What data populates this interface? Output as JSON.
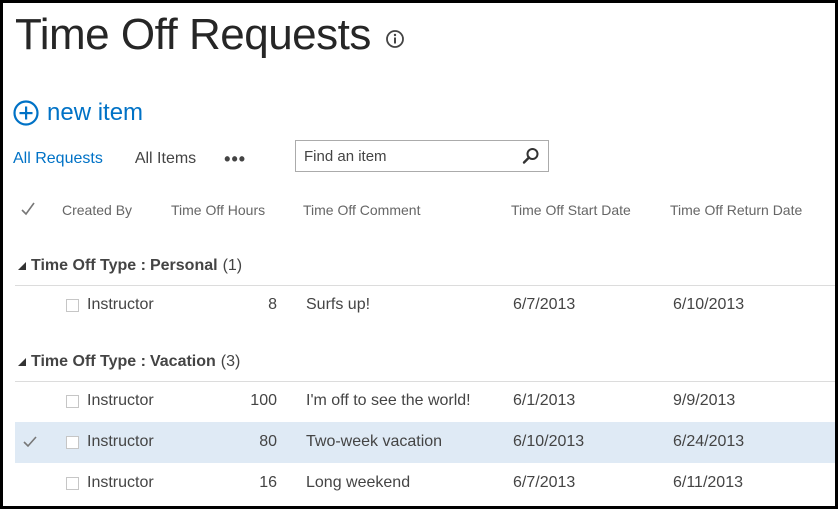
{
  "page": {
    "title": "Time Off Requests"
  },
  "toolbar": {
    "new_item_label": "new item"
  },
  "views": {
    "items": [
      "All Requests",
      "All Items"
    ],
    "more": "•••"
  },
  "search": {
    "placeholder": "Find an item"
  },
  "columns": [
    "Created By",
    "Time Off Hours",
    "Time Off Comment",
    "Time Off Start Date",
    "Time Off Return Date"
  ],
  "groups": [
    {
      "label": "Time Off Type :",
      "value": "Personal",
      "count": "(1)",
      "rows": [
        {
          "created_by": "Instructor",
          "hours": "8",
          "comment": "Surfs up!",
          "start": "6/7/2013",
          "return": "6/10/2013",
          "selected": false
        }
      ]
    },
    {
      "label": "Time Off Type :",
      "value": "Vacation",
      "count": "(3)",
      "rows": [
        {
          "created_by": "Instructor",
          "hours": "100",
          "comment": "I'm off to see the world!",
          "start": "6/1/2013",
          "return": "9/9/2013",
          "selected": false
        },
        {
          "created_by": "Instructor",
          "hours": "80",
          "comment": "Two-week vacation",
          "start": "6/10/2013",
          "return": "6/24/2013",
          "selected": true
        },
        {
          "created_by": "Instructor",
          "hours": "16",
          "comment": "Long weekend",
          "start": "6/7/2013",
          "return": "6/11/2013",
          "selected": false
        }
      ]
    }
  ],
  "colors": {
    "accent": "#0072c6",
    "selected_row": "#dfeaf5",
    "title": "#262626",
    "text": "#444444"
  },
  "icons": {
    "info": "info-icon",
    "new_item": "plus-circle-icon",
    "search": "magnifier-icon",
    "select_all": "checkmark-icon",
    "group_toggle": "triangle-collapse-icon",
    "row_select": "checkbox-icon"
  }
}
